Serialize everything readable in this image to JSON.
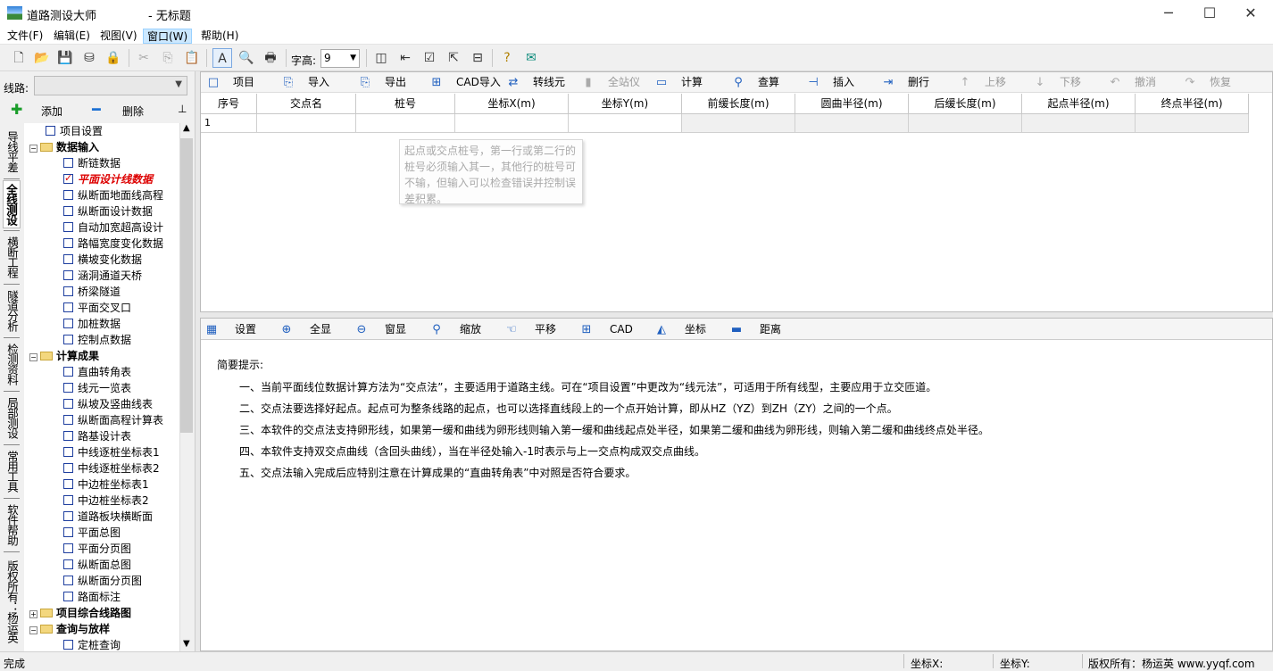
{
  "window": {
    "app_title": "道路测设大师",
    "doc_title": "- 无标题",
    "minimize": "─",
    "maximize": "☐",
    "close": "✕"
  },
  "menu": [
    "文件(F)",
    "编辑(E)",
    "视图(V)",
    "窗口(W)",
    "帮助(H)"
  ],
  "toolbar": {
    "font_size_label": "字高:",
    "font_size_value": "9"
  },
  "left": {
    "route_label": "线路:",
    "add_label": "添加",
    "delete_label": "删除",
    "vtabs": [
      "导线平差",
      "全线测设",
      "横断工程",
      "隧道分析",
      "检测资料",
      "局部测设",
      "常用工具",
      "软件帮助",
      "版权所有：杨运英"
    ],
    "tree": [
      {
        "label": "项目设置",
        "level": 1,
        "kind": "check"
      },
      {
        "label": "数据输入",
        "level": 0,
        "kind": "folder",
        "bold": true
      },
      {
        "label": "断链数据",
        "level": 2,
        "kind": "check"
      },
      {
        "label": "平面设计线数据",
        "level": 2,
        "kind": "check",
        "checked": true
      },
      {
        "label": "纵断面地面线高程",
        "level": 2,
        "kind": "check"
      },
      {
        "label": "纵断面设计数据",
        "level": 2,
        "kind": "check"
      },
      {
        "label": "自动加宽超高设计",
        "level": 2,
        "kind": "check"
      },
      {
        "label": "路幅宽度变化数据",
        "level": 2,
        "kind": "check"
      },
      {
        "label": "横坡变化数据",
        "level": 2,
        "kind": "check"
      },
      {
        "label": "涵洞通道天桥",
        "level": 2,
        "kind": "check"
      },
      {
        "label": "桥梁隧道",
        "level": 2,
        "kind": "check"
      },
      {
        "label": "平面交叉口",
        "level": 2,
        "kind": "check"
      },
      {
        "label": "加桩数据",
        "level": 2,
        "kind": "check"
      },
      {
        "label": "控制点数据",
        "level": 2,
        "kind": "check"
      },
      {
        "label": "计算成果",
        "level": 0,
        "kind": "folder",
        "bold": true
      },
      {
        "label": "直曲转角表",
        "level": 2,
        "kind": "check"
      },
      {
        "label": "线元一览表",
        "level": 2,
        "kind": "check"
      },
      {
        "label": "纵坡及竖曲线表",
        "level": 2,
        "kind": "check"
      },
      {
        "label": "纵断面高程计算表",
        "level": 2,
        "kind": "check"
      },
      {
        "label": "路基设计表",
        "level": 2,
        "kind": "check"
      },
      {
        "label": "中线逐桩坐标表1",
        "level": 2,
        "kind": "check"
      },
      {
        "label": "中线逐桩坐标表2",
        "level": 2,
        "kind": "check"
      },
      {
        "label": "中边桩坐标表1",
        "level": 2,
        "kind": "check"
      },
      {
        "label": "中边桩坐标表2",
        "level": 2,
        "kind": "check"
      },
      {
        "label": "道路板块横断面",
        "level": 2,
        "kind": "check"
      },
      {
        "label": "平面总图",
        "level": 2,
        "kind": "check"
      },
      {
        "label": "平面分页图",
        "level": 2,
        "kind": "check"
      },
      {
        "label": "纵断面总图",
        "level": 2,
        "kind": "check"
      },
      {
        "label": "纵断面分页图",
        "level": 2,
        "kind": "check"
      },
      {
        "label": "路面标注",
        "level": 2,
        "kind": "check"
      },
      {
        "label": "项目综合线路图",
        "level": 0,
        "kind": "folder",
        "bold": true,
        "collapsed": true
      },
      {
        "label": "查询与放样",
        "level": 0,
        "kind": "folder",
        "bold": true
      },
      {
        "label": "定桩查询",
        "level": 2,
        "kind": "check"
      }
    ]
  },
  "data_toolbar": [
    {
      "label": "项目",
      "icon": "□",
      "name": "project"
    },
    {
      "label": "导入",
      "icon": "⎘",
      "name": "import"
    },
    {
      "label": "导出",
      "icon": "⎘",
      "name": "export"
    },
    {
      "label": "CAD导入",
      "icon": "⊞",
      "name": "cad-import"
    },
    {
      "label": "转线元",
      "icon": "⇄",
      "name": "convert-element"
    },
    {
      "label": "全站仪",
      "icon": "▮",
      "name": "total-station",
      "disabled": true
    },
    {
      "label": "计算",
      "icon": "▭",
      "name": "calculate"
    },
    {
      "label": "查算",
      "icon": "⚲",
      "name": "lookup"
    },
    {
      "label": "插入",
      "icon": "⊣",
      "name": "insert"
    },
    {
      "label": "删行",
      "icon": "⇥",
      "name": "delete-row"
    },
    {
      "label": "上移",
      "icon": "↑",
      "name": "move-up",
      "disabled": true
    },
    {
      "label": "下移",
      "icon": "↓",
      "name": "move-down",
      "disabled": true
    },
    {
      "label": "撤消",
      "icon": "↶",
      "name": "undo",
      "disabled": true
    },
    {
      "label": "恢复",
      "icon": "↷",
      "name": "redo",
      "disabled": true
    }
  ],
  "grid": {
    "columns": [
      "序号",
      "交点名",
      "桩号",
      "坐标X(m)",
      "坐标Y(m)",
      "前缓长度(m)",
      "圆曲半径(m)",
      "后缓长度(m)",
      "起点半径(m)",
      "终点半径(m)"
    ],
    "rows": [
      [
        "1",
        "",
        "",
        "",
        "",
        "",
        "",
        "",
        "",
        ""
      ]
    ]
  },
  "tooltip": "起点或交点桩号，第一行或第二行的桩号必须输入其一，其他行的桩号可不输，但输入可以检查错误并控制误差积累。",
  "view_toolbar": [
    {
      "label": "设置",
      "icon": "▦",
      "name": "settings"
    },
    {
      "label": "全显",
      "icon": "⊕",
      "name": "zoom-extents"
    },
    {
      "label": "窗显",
      "icon": "⊖",
      "name": "zoom-window"
    },
    {
      "label": "缩放",
      "icon": "⚲",
      "name": "zoom"
    },
    {
      "label": "平移",
      "icon": "☜",
      "name": "pan"
    },
    {
      "label": "CAD",
      "icon": "⊞",
      "name": "cad"
    },
    {
      "label": "坐标",
      "icon": "◭",
      "name": "coordinate"
    },
    {
      "label": "距离",
      "icon": "▬",
      "name": "distance"
    }
  ],
  "tips": {
    "title": "简要提示:",
    "items": [
      "一、当前平面线位数据计算方法为“交点法”，主要适用于道路主线。可在“项目设置”中更改为“线元法”，可适用于所有线型，主要应用于立交匝道。",
      "二、交点法要选择好起点。起点可为整条线路的起点，也可以选择直线段上的一个点开始计算，即从HZ（YZ）到ZH（ZY）之间的一个点。",
      "三、本软件的交点法支持卵形线，如果第一缓和曲线为卵形线则输入第一缓和曲线起点处半径，如果第二缓和曲线为卵形线，则输入第二缓和曲线终点处半径。",
      "四、本软件支持双交点曲线（含回头曲线），当在半径处输入-1时表示与上一交点构成双交点曲线。",
      "五、交点法输入完成后应特别注意在计算成果的“直曲转角表”中对照是否符合要求。"
    ]
  },
  "status": {
    "left": "完成",
    "x_label": "坐标X:",
    "y_label": "坐标Y:",
    "copyright": "版权所有：杨运英 www.yyqf.com"
  }
}
